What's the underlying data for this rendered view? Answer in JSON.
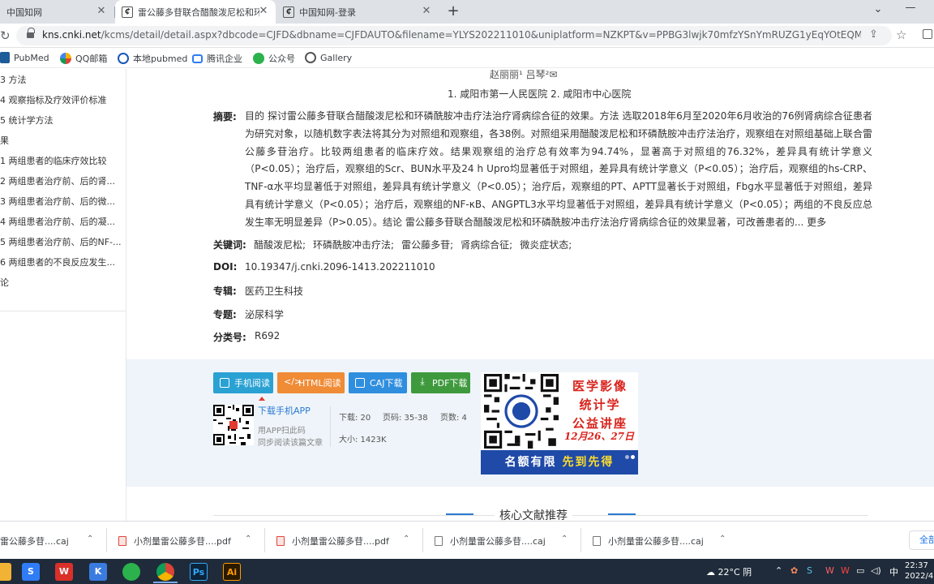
{
  "tabs": [
    {
      "title": "中国知网",
      "active": false
    },
    {
      "title": "雷公藤多苷联合醋酸泼尼松和环磷",
      "active": true,
      "favicon": "cnki-icon"
    },
    {
      "title": "中国知网-登录",
      "active": false,
      "favicon": "cnki-icon"
    }
  ],
  "address_bar": {
    "host": "kns.cnki.net",
    "path": "/kcms/detail/detail.aspx?dbcode=CJFD&dbname=CJFDAUTO&filename=YLYS202211010&uniplatform=NZKPT&v=PPBG3lwjk70mfzYSnYmRUZG1yEqYOtEQMuX2k-41T..."
  },
  "bookmarks": [
    "PubMed",
    "QQ邮箱",
    "本地pubmed",
    "腾讯企业",
    "公众号",
    "Gallery"
  ],
  "toc": [
    "3 方法",
    "4 观察指标及疗效评价标准",
    "5 统计学方法",
    "果",
    "1 两组患者的临床疗效比较",
    "2 两组患者治疗前、后的肾...",
    "3 两组患者治疗前、后的微...",
    "4 两组患者治疗前、后的凝...",
    "5 两组患者治疗前、后的NF-...",
    "6 两组患者的不良反应发生...",
    "论"
  ],
  "article": {
    "authors_partial": "赵丽丽¹   吕琴²✉",
    "affiliations": "1. 咸阳市第一人民医院   2. 咸阳市中心医院",
    "abstract_label": "摘要:",
    "abstract": "目的 探讨雷公藤多苷联合醋酸泼尼松和环磷酰胺冲击疗法治疗肾病综合征的效果。方法 选取2018年6月至2020年6月收治的76例肾病综合征患者为研究对象，以随机数字表法将其分为对照组和观察组，各38例。对照组采用醋酸泼尼松和环磷酰胺冲击疗法治疗，观察组在对照组基础上联合雷公藤多苷治疗。比较两组患者的临床疗效。结果观察组的治疗总有效率为94.74%，显著高于对照组的76.32%，差异具有统计学意义（P<0.05）；治疗后，观察组的Scr、BUN水平及24 h Upro均显著低于对照组，差异具有统计学意义（P<0.05）；治疗后，观察组的hs-CRP、TNF-α水平均显著低于对照组，差异具有统计学意义（P<0.05）；治疗后，观察组的PT、APTT显著长于对照组，Fbg水平显著低于对照组，差异具有统计学意义（P<0.05）；治疗后，观察组的NF-κB、ANGPTL3水平均显著低于对照组，差异具有统计学意义（P<0.05）；两组的不良反应总发生率无明显差异（P>0.05）。结论 雷公藤多苷联合醋酸泼尼松和环磷酰胺冲击疗法治疗肾病综合征的效果显著，可改善患者的...",
    "more_label": "更多",
    "keywords_label": "关键词:",
    "keywords": [
      "醋酸泼尼松;",
      "环磷酰胺冲击疗法;",
      "雷公藤多苷;",
      "肾病综合征;",
      "微炎症状态;"
    ],
    "doi_label": "DOI:",
    "doi": "10.19347/j.cnki.2096-1413.202211010",
    "series_label": "专辑:",
    "series": "医药卫生科技",
    "subject_label": "专题:",
    "subject": "泌尿科学",
    "class_label": "分类号:",
    "class_no": "R692"
  },
  "download": {
    "buttons": [
      {
        "label": "手机阅读",
        "color": "#2aa1d3",
        "icon": "phone-icon"
      },
      {
        "label": "HTML阅读",
        "color": "#f08b36",
        "icon": "code-icon"
      },
      {
        "label": "CAJ下载",
        "color": "#2f8ede",
        "icon": "book-icon"
      },
      {
        "label": "PDF下载",
        "color": "#3f9a3d",
        "icon": "pdf-icon"
      }
    ],
    "app_title": "下载手机APP",
    "app_sub1": "用APP扫此码",
    "app_sub2": "同步阅读该篇文章",
    "downloads": "下载:  20",
    "pages_range": "页码:  35-38",
    "page_count": "页数:  4",
    "size": "大小:  1423K"
  },
  "promo": {
    "line1": "医学影像",
    "line2": "统计学",
    "line3": "公益讲座",
    "date": "12月26、27日",
    "bar_a": "名额有限 ",
    "bar_b": "先到先得"
  },
  "core_title": "核心文献推荐",
  "shelf": [
    {
      "name": "雷公藤多苷....caj",
      "type": "caj"
    },
    {
      "name": "小剂量雷公藤多苷....pdf",
      "type": "pdf"
    },
    {
      "name": "小剂量雷公藤多苷....pdf",
      "type": "pdf"
    },
    {
      "name": "小剂量雷公藤多苷....caj",
      "type": "caj"
    },
    {
      "name": "小剂量雷公藤多苷....caj",
      "type": "caj"
    }
  ],
  "shelf_showall": "全部",
  "taskbar": {
    "weather": "22°C  阴",
    "ime": "中",
    "time": "22:37",
    "date": "2022/4"
  }
}
